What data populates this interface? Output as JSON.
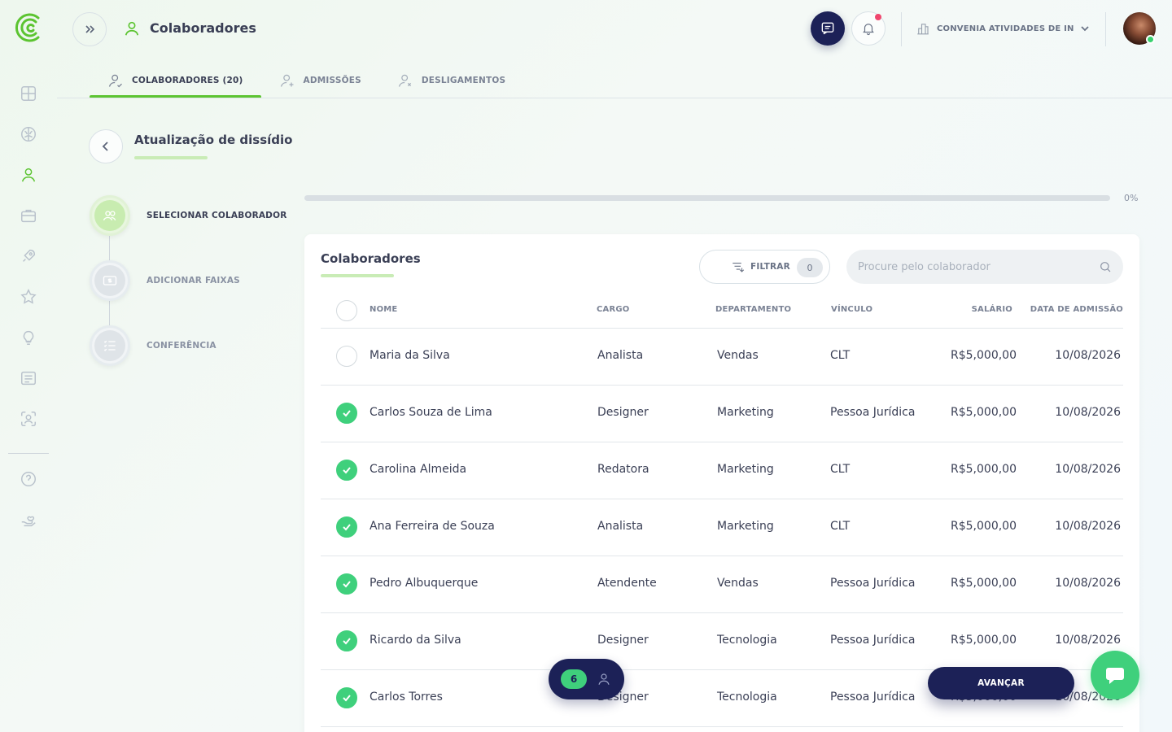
{
  "header": {
    "title": "Colaboradores",
    "company": "CONVENIA ATIVIDADES DE IN..."
  },
  "tabs": [
    {
      "label": "COLABORADORES (20)",
      "active": true
    },
    {
      "label": "ADMISSÕES",
      "active": false
    },
    {
      "label": "DESLIGAMENTOS",
      "active": false
    }
  ],
  "section": {
    "title": "Atualização de dissídio"
  },
  "steps": [
    {
      "label": "SELECIONAR COLABORADOR",
      "active": true
    },
    {
      "label": "ADICIONAR FAIXAS",
      "active": false
    },
    {
      "label": "CONFERÊNCIA",
      "active": false
    }
  ],
  "progress": {
    "value": 0,
    "text": "0%"
  },
  "card": {
    "title": "Colaboradores",
    "filter_label": "FILTRAR",
    "filter_count": "0",
    "search_placeholder": "Procure pelo colaborador"
  },
  "table": {
    "headers": {
      "nome": "NOME",
      "cargo": "CARGO",
      "departamento": "DEPARTAMENTO",
      "vinculo": "VÍNCULO",
      "salario": "SALÁRIO",
      "admissao": "DATA DE ADMISSÃO"
    },
    "rows": [
      {
        "checked": false,
        "nome": "Maria da Silva",
        "cargo": "Analista",
        "departamento": "Vendas",
        "vinculo": "CLT",
        "salario": "R$5,000,00",
        "admissao": "10/08/2026"
      },
      {
        "checked": true,
        "nome": "Carlos Souza de Lima",
        "cargo": "Designer",
        "departamento": "Marketing",
        "vinculo": "Pessoa Jurídica",
        "salario": "R$5,000,00",
        "admissao": "10/08/2026"
      },
      {
        "checked": true,
        "nome": "Carolina Almeida",
        "cargo": "Redatora",
        "departamento": "Marketing",
        "vinculo": "CLT",
        "salario": "R$5,000,00",
        "admissao": "10/08/2026"
      },
      {
        "checked": true,
        "nome": "Ana Ferreira de Souza",
        "cargo": "Analista",
        "departamento": "Marketing",
        "vinculo": "CLT",
        "salario": "R$5,000,00",
        "admissao": "10/08/2026"
      },
      {
        "checked": true,
        "nome": "Pedro Albuquerque",
        "cargo": "Atendente",
        "departamento": "Vendas",
        "vinculo": "Pessoa Jurídica",
        "salario": "R$5,000,00",
        "admissao": "10/08/2026"
      },
      {
        "checked": true,
        "nome": "Ricardo da Silva",
        "cargo": "Designer",
        "departamento": "Tecnologia",
        "vinculo": "Pessoa Jurídica",
        "salario": "R$5,000,00",
        "admissao": "10/08/2026"
      },
      {
        "checked": true,
        "nome": "Carlos Torres",
        "cargo": "Designer",
        "departamento": "Tecnologia",
        "vinculo": "Pessoa Jurídica",
        "salario": "R$5,000,00",
        "admissao": "10/08/2026"
      }
    ]
  },
  "selection": {
    "count": "6"
  },
  "actions": {
    "advance_label": "AVANÇAR"
  },
  "colors": {
    "accent": "#5cc431",
    "navy": "#1c2157",
    "check": "#3fd07c",
    "notification": "#f0466e"
  }
}
